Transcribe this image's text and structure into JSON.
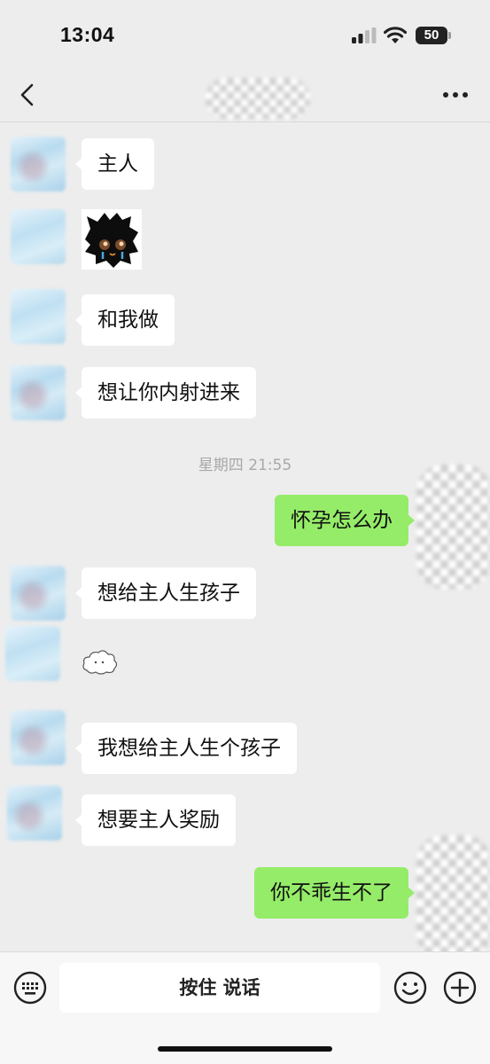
{
  "status_bar": {
    "time": "13:04",
    "battery": "50",
    "icons": [
      "signal-icon",
      "wifi-icon",
      "battery-icon"
    ]
  },
  "nav": {
    "back_icon": "chevron-left-icon",
    "more_icon": "more-dots-icon"
  },
  "messages": [
    {
      "side": "in",
      "text": "主人"
    },
    {
      "side": "in",
      "sticker": "black-cat-crying-sticker"
    },
    {
      "side": "in",
      "text": "和我做"
    },
    {
      "side": "in",
      "text": "想让你内射进来"
    },
    {
      "timestamp": "星期四 21:55"
    },
    {
      "side": "out",
      "text": "怀孕怎么办"
    },
    {
      "side": "in",
      "text": "想给主人生孩子"
    },
    {
      "side": "in",
      "sticker": "cloud-sticker"
    },
    {
      "side": "in",
      "text": "我想给主人生个孩子"
    },
    {
      "side": "in",
      "text": "想要主人奖励"
    },
    {
      "side": "out",
      "text": "你不乖生不了"
    }
  ],
  "input_bar": {
    "voice_label": "按住 说话",
    "icons": [
      "keyboard-icon",
      "emoji-icon",
      "plus-icon"
    ]
  },
  "colors": {
    "background": "#ededed",
    "incoming_bubble": "#ffffff",
    "outgoing_bubble": "#95ec69",
    "timestamp": "#a8a8a8"
  }
}
